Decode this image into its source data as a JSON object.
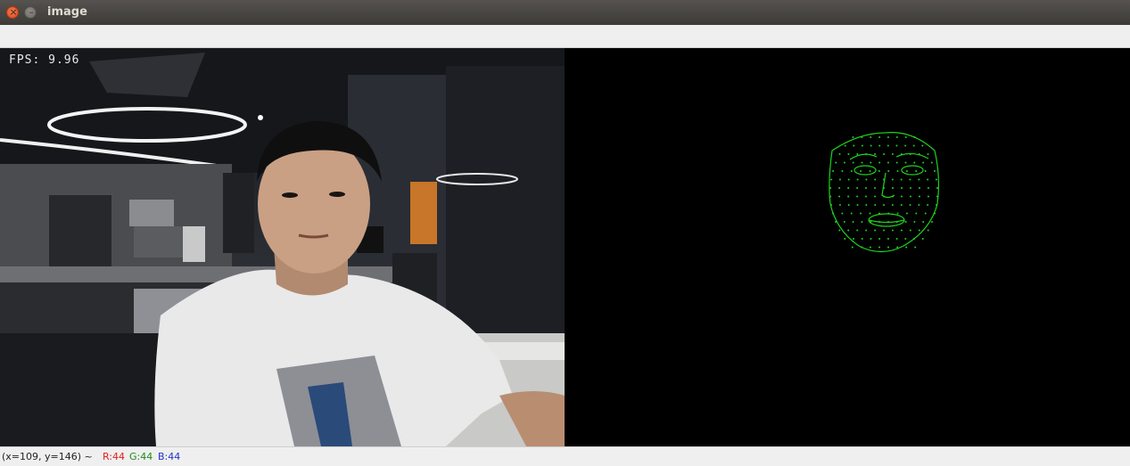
{
  "window": {
    "title": "image"
  },
  "overlay": {
    "fps": "FPS: 9.96"
  },
  "status": {
    "coords": "(x=109, y=146) ~",
    "r": "R:44",
    "g": "G:44",
    "b": "B:44"
  },
  "colors": {
    "mesh": "#1fd21f",
    "status_r": "#e02020",
    "status_g": "#1f8a1f",
    "status_b": "#2030d0"
  },
  "icons": {
    "close": "close-icon",
    "minimize": "minimize-icon"
  }
}
